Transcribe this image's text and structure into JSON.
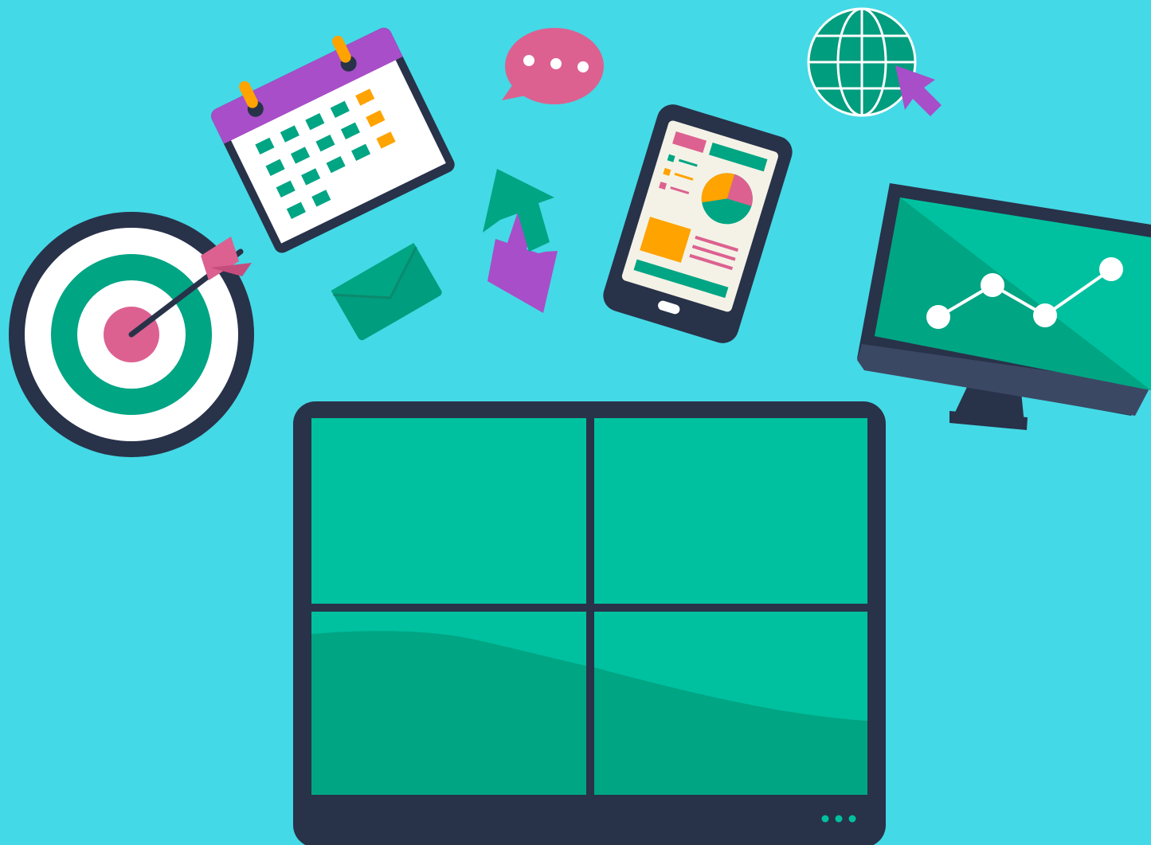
{
  "colors": {
    "background": "#44d9e6",
    "navy": "#283249",
    "green_light": "#00c19f",
    "green_dark": "#00a584",
    "green_mid": "#009d7e",
    "pink": "#dc6190",
    "purple": "#a84ec8",
    "orange": "#ffa300",
    "white": "#ffffff",
    "cream": "#f4f2e6"
  },
  "icons": [
    "target-icon",
    "arrow-icon",
    "calendar-icon",
    "speech-bubble-icon",
    "envelope-icon",
    "exchange-arrows-icon",
    "tablet-dashboard-icon",
    "pie-chart-icon",
    "globe-icon",
    "cursor-icon",
    "monitor-icon",
    "line-chart-icon",
    "large-screen-display"
  ],
  "line_chart_values": [
    1,
    2,
    1,
    3
  ]
}
